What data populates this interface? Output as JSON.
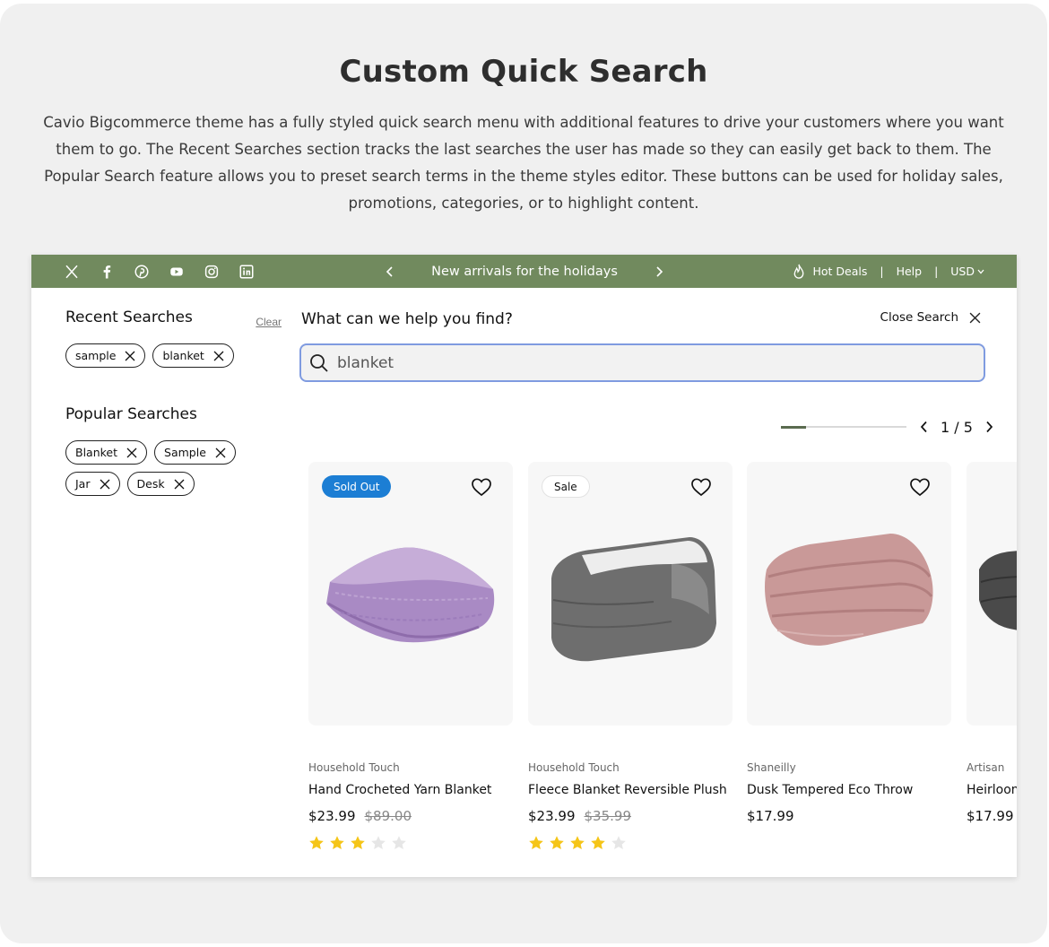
{
  "headline": "Custom Quick Search",
  "intro": "Cavio Bigcommerce theme has a fully styled quick search menu with additional features to drive your customers where you want them to go. The Recent Searches section tracks the last searches the user has made so they can easily get back to them. The Popular Search feature allows you to preset search terms in the theme styles editor. These buttons can be used for holiday sales, promotions, categories, or to highlight content.",
  "topbar": {
    "social_icons": [
      "x-icon",
      "facebook-icon",
      "pinterest-icon",
      "youtube-icon",
      "instagram-icon",
      "linkedin-icon"
    ],
    "promo_text": "New arrivals for the holidays",
    "hot_deals": "Hot Deals",
    "separator": "|",
    "help": "Help",
    "currency": "USD",
    "bg_color": "#718a5e"
  },
  "recent": {
    "title": "Recent Searches",
    "clear_label": "Clear",
    "items": [
      "sample",
      "blanket"
    ]
  },
  "popular": {
    "title": "Popular Searches",
    "items": [
      "Blanket",
      "Sample",
      "Jar",
      "Desk"
    ]
  },
  "search": {
    "prompt": "What can we help you find?",
    "close_label": "Close Search",
    "value": "blanket"
  },
  "pager": {
    "current": 1,
    "total": 5,
    "label": "1 / 5",
    "progress": 0.2
  },
  "products": [
    {
      "badge": "Sold Out",
      "brand": "Household Touch",
      "name": "Hand Crocheted Yarn Blanket",
      "price": "$23.99",
      "old_price": "$89.00",
      "rating": 3
    },
    {
      "badge": "Sale",
      "brand": "Household Touch",
      "name": "Fleece Blanket Reversible Plush",
      "price": "$23.99",
      "old_price": "$35.99",
      "rating": 4
    },
    {
      "badge": "",
      "brand": "Shaneilly",
      "name": "Dusk Tempered Eco Throw",
      "price": "$17.99",
      "old_price": "",
      "rating": 0
    },
    {
      "badge": "",
      "brand": "Artisan",
      "name": "Heirloom",
      "price": "$17.99",
      "old_price": "",
      "rating": 0
    }
  ],
  "colors": {
    "sold_out_badge": "#1c7ed4",
    "star_filled": "#f5c518",
    "star_empty": "#e6e6e6",
    "search_border": "#7f9be0"
  }
}
